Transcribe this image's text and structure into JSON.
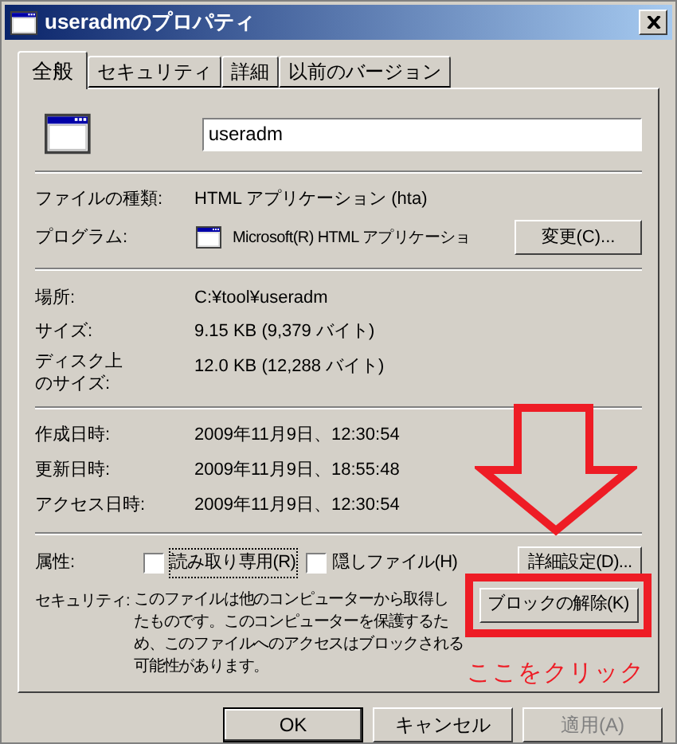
{
  "window": {
    "title": "useradmのプロパティ"
  },
  "tabs": [
    {
      "label": "全般",
      "selected": true
    },
    {
      "label": "セキュリティ",
      "selected": false
    },
    {
      "label": "詳細",
      "selected": false
    },
    {
      "label": "以前のバージョン",
      "selected": false
    }
  ],
  "file_name": "useradm",
  "file_type": {
    "label": "ファイルの種類:",
    "value": "HTML アプリケーション (hta)"
  },
  "program": {
    "label": "プログラム:",
    "value": "Microsoft(R) HTML アプリケーショ",
    "button": "変更(C)..."
  },
  "location": {
    "label": "場所:",
    "value": "C:¥tool¥useradm"
  },
  "size": {
    "label": "サイズ:",
    "value": "9.15 KB (9,379 バイト)"
  },
  "size_on_disk": {
    "label_lines": [
      "ディスク上",
      "のサイズ:"
    ],
    "value": "12.0 KB (12,288 バイト)"
  },
  "dates": [
    {
      "label": "作成日時:",
      "value": "2009年11月9日、12:30:54"
    },
    {
      "label": "更新日時:",
      "value": "2009年11月9日、18:55:48"
    },
    {
      "label": "アクセス日時:",
      "value": "2009年11月9日、12:30:54"
    }
  ],
  "attributes": {
    "label": "属性:",
    "checkboxes": [
      {
        "label": "読み取り専用(R)",
        "checked": false,
        "focused": true
      },
      {
        "label": "隠しファイル(H)",
        "checked": false,
        "focused": false
      }
    ],
    "button": "詳細設定(D)..."
  },
  "security": {
    "label": "セキュリティ:",
    "lines": [
      "このファイルは他のコンピューターから取得し",
      "たものです。このコンピューターを保護するた",
      "め、このファイルへのアクセスはブロックされる",
      "可能性があります。"
    ],
    "button": "ブロックの解除(K)"
  },
  "buttons": [
    {
      "label": "OK",
      "disabled": false
    },
    {
      "label": "キャンセル",
      "disabled": false
    },
    {
      "label": "適用(A)",
      "disabled": true
    }
  ],
  "annotation": {
    "caption": "ここをクリック"
  }
}
